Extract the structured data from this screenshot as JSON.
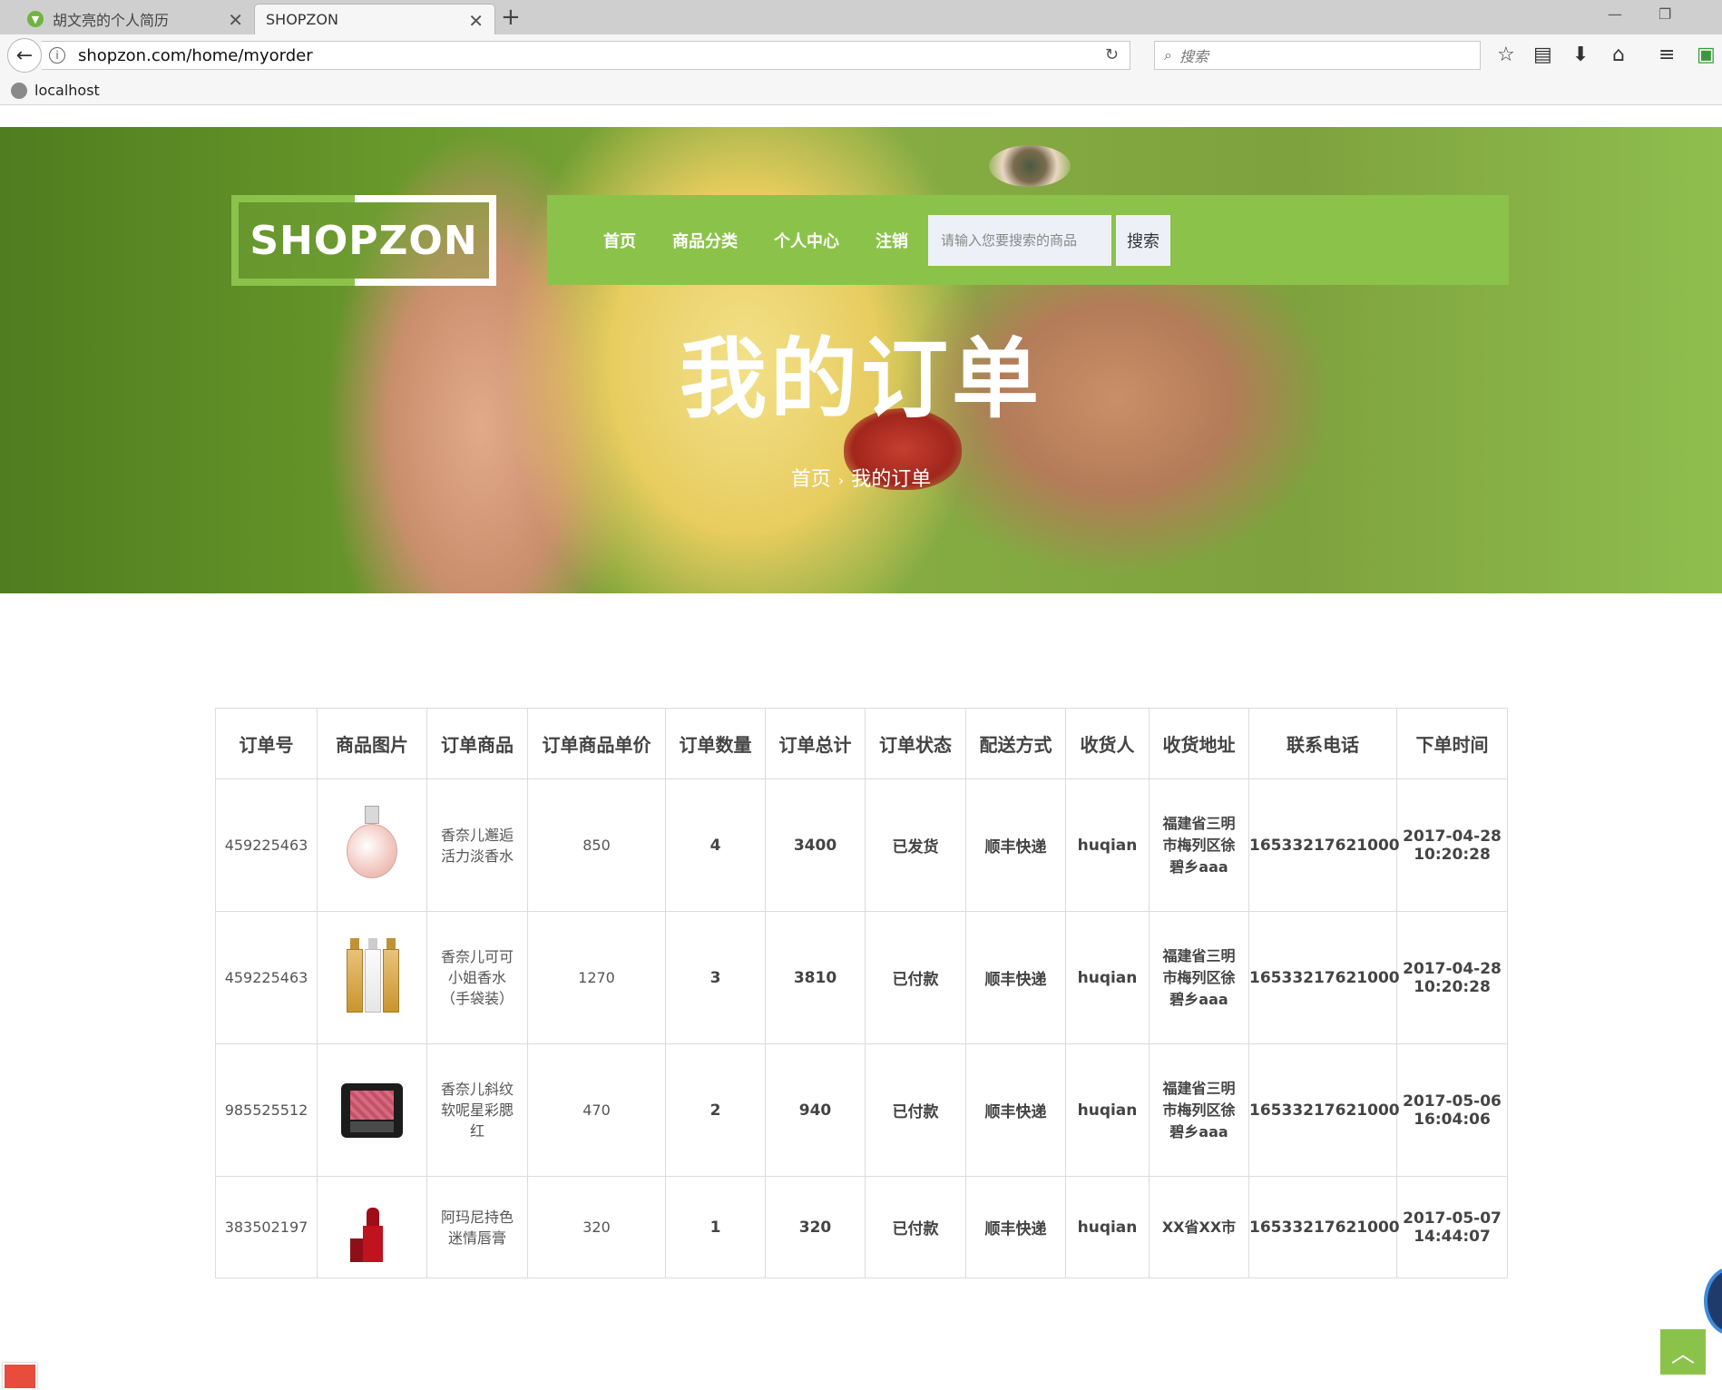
{
  "browser": {
    "tabs": [
      {
        "title": "胡文亮的个人简历"
      },
      {
        "title": "SHOPZON"
      }
    ],
    "url": "shopzon.com/home/myorder",
    "search_placeholder": "搜索",
    "bookmarks": [
      {
        "label": "localhost"
      }
    ]
  },
  "site": {
    "logo": "SHOPZON",
    "nav": [
      {
        "label": "首页"
      },
      {
        "label": "商品分类"
      },
      {
        "label": "个人中心"
      },
      {
        "label": "注销"
      }
    ],
    "search_placeholder": "请输入您要搜索的商品",
    "search_button": "搜索",
    "hero_title": "我的订单",
    "breadcrumb": {
      "home": "首页",
      "separator": "›",
      "current": "我的订单"
    }
  },
  "orders": {
    "headers": [
      "订单号",
      "商品图片",
      "订单商品",
      "订单商品单价",
      "订单数量",
      "订单总计",
      "订单状态",
      "配送方式",
      "收货人",
      "收货地址",
      "联系电话",
      "下单时间"
    ],
    "rows": [
      {
        "id": "459225463",
        "image": "perfume-bottle",
        "product": "香奈儿邂逅活力淡香水",
        "price": "850",
        "qty": "4",
        "total": "3400",
        "status": "已发货",
        "shipping": "顺丰快递",
        "receiver": "huqian",
        "address": "福建省三明市梅列区徐碧乡aaa",
        "phone": "16533217621000",
        "date": "2017-04-28",
        "time": "10:20:28"
      },
      {
        "id": "459225463",
        "image": "twin-perfume-bottles",
        "product": "香奈儿可可小姐香水（手袋装）",
        "price": "1270",
        "qty": "3",
        "total": "3810",
        "status": "已付款",
        "shipping": "顺丰快递",
        "receiver": "huqian",
        "address": "福建省三明市梅列区徐碧乡aaa",
        "phone": "16533217621000",
        "date": "2017-04-28",
        "time": "10:20:28"
      },
      {
        "id": "985525512",
        "image": "blush-compact",
        "product": "香奈儿斜纹软呢星彩腮红",
        "price": "470",
        "qty": "2",
        "total": "940",
        "status": "已付款",
        "shipping": "顺丰快递",
        "receiver": "huqian",
        "address": "福建省三明市梅列区徐碧乡aaa",
        "phone": "16533217621000",
        "date": "2017-05-06",
        "time": "16:04:06"
      },
      {
        "id": "383502197",
        "image": "lipstick",
        "product": "阿玛尼持色迷情唇膏",
        "price": "320",
        "qty": "1",
        "total": "320",
        "status": "已付款",
        "shipping": "顺丰快递",
        "receiver": "huqian",
        "address": "XX省XX市",
        "phone": "16533217621000",
        "date": "2017-05-07",
        "time": "14:44:07"
      }
    ]
  },
  "colors": {
    "accent": "#8bc34a",
    "hero_green": "#6b9a2c",
    "text": "#444444"
  }
}
